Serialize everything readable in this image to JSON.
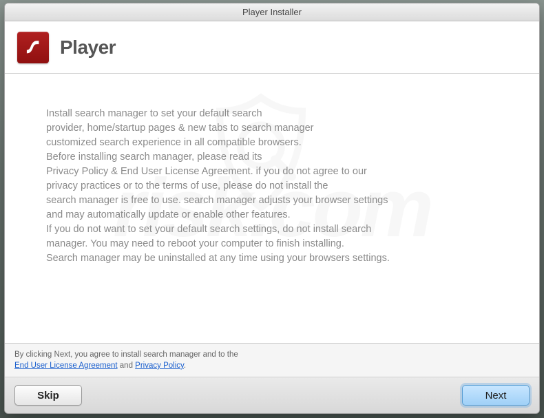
{
  "window": {
    "title": "Player Installer"
  },
  "header": {
    "app_name": "Player"
  },
  "body": {
    "lines": [
      "Install search manager to set your default search",
      "provider, home/startup pages & new tabs to search manager",
      "customized search experience in all compatible browsers.",
      "Before installing search manager, please read its",
      "Privacy Policy & End User License Agreement. if you do not agree to our",
      "privacy practices or to the terms of use, please do not install the",
      "search manager is free to use. search manager adjusts your browser settings",
      "and may automatically update or enable other features.",
      "If you do not want to set your default search settings, do not install search",
      "manager. You may need to reboot your computer to finish installing.",
      "Search manager may be uninstalled at any time using your browsers settings."
    ]
  },
  "eula": {
    "prefix": "By clicking Next, you agree to install search manager and to the",
    "link1": "End User License Agreement",
    "and": " and ",
    "link2": "Privacy Policy",
    "suffix": "."
  },
  "buttons": {
    "skip": "Skip",
    "next": "Next"
  }
}
